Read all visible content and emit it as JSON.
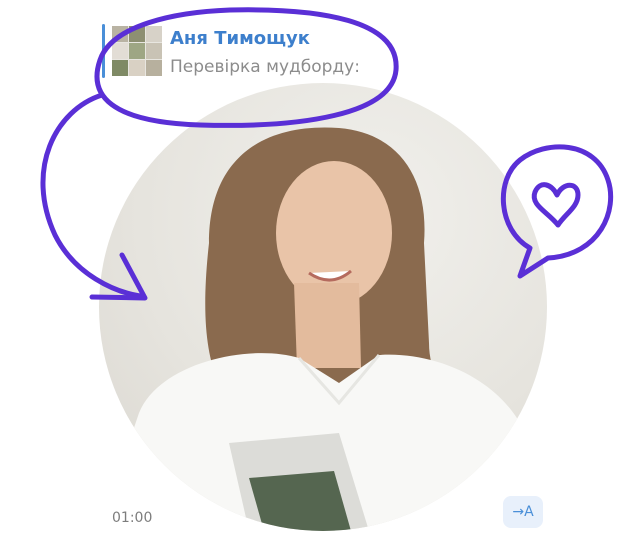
{
  "reply": {
    "author": "Аня Тимощук",
    "snippet": "Перевірка мудборду:"
  },
  "message": {
    "time": "01:00",
    "translate_label": "→A"
  },
  "colors": {
    "accent": "#3d7fcc",
    "annotation": "#5a2fd6"
  }
}
